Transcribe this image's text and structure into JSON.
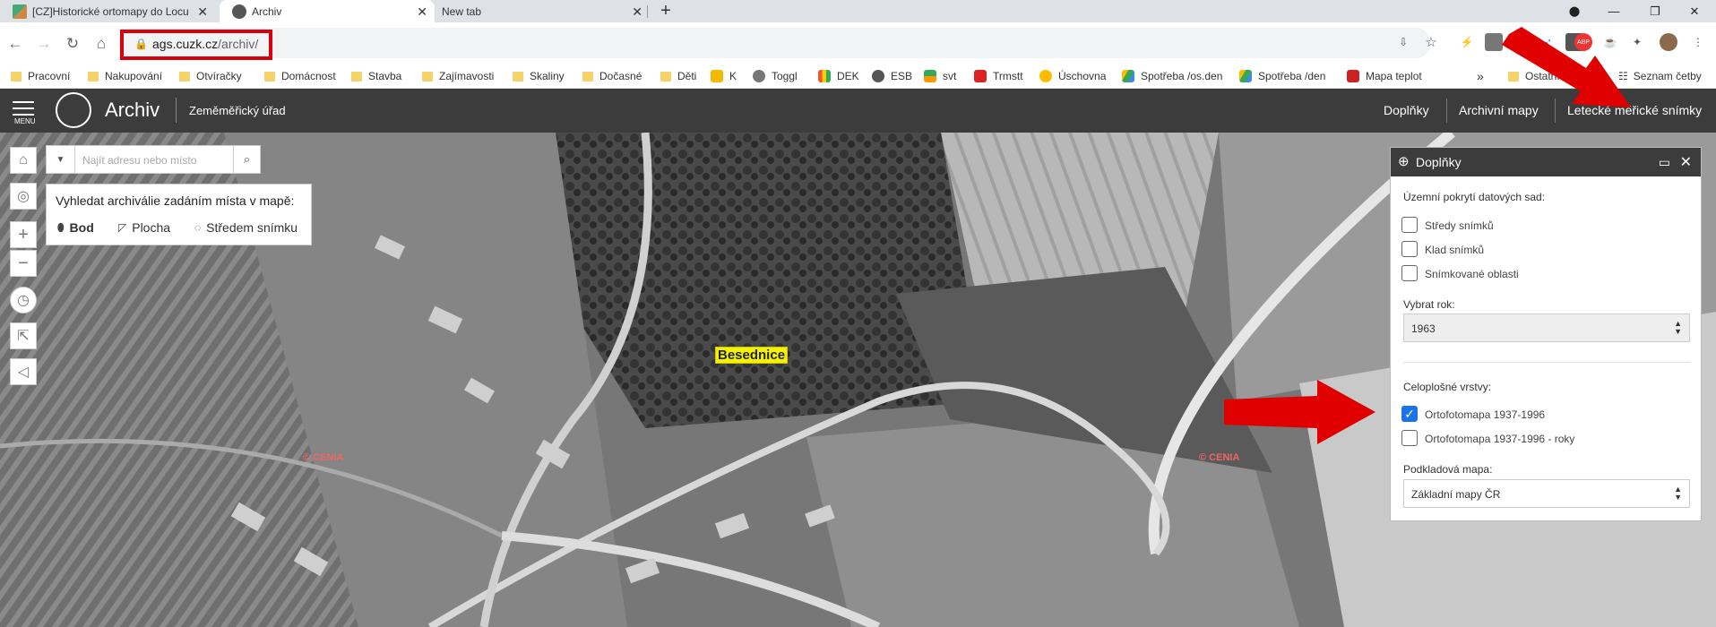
{
  "browser": {
    "tabs": [
      {
        "title": "[CZ]Historické ortomapy do Locu",
        "active": false
      },
      {
        "title": "Archiv",
        "active": true
      },
      {
        "title": "New tab",
        "active": false
      }
    ],
    "new_tab_icon": "plus-icon",
    "url": {
      "host": "ags.cuzk.cz",
      "path": "/archiv/"
    },
    "window_controls": [
      "minimize-icon",
      "restore-icon",
      "close-icon"
    ]
  },
  "bookmarks": [
    {
      "label": "Pracovní",
      "icon": "folder"
    },
    {
      "label": "Nakupování",
      "icon": "folder"
    },
    {
      "label": "Otvíračky",
      "icon": "folder"
    },
    {
      "label": "Domácnost",
      "icon": "folder"
    },
    {
      "label": "Stavba",
      "icon": "folder"
    },
    {
      "label": "Zajímavosti",
      "icon": "folder"
    },
    {
      "label": "Skaliny",
      "icon": "folder"
    },
    {
      "label": "Dočasné",
      "icon": "folder"
    },
    {
      "label": "Děti",
      "icon": "folder"
    },
    {
      "label": "K",
      "icon": "site"
    },
    {
      "label": "Toggl",
      "icon": "site"
    },
    {
      "label": "DEK",
      "icon": "site"
    },
    {
      "label": "ESB",
      "icon": "site"
    },
    {
      "label": "svt",
      "icon": "site"
    },
    {
      "label": "Trmstt",
      "icon": "site"
    },
    {
      "label": "Úschovna",
      "icon": "site"
    },
    {
      "label": "Spotřeba /os.den",
      "icon": "drive"
    },
    {
      "label": "Spotřeba /den",
      "icon": "drive"
    },
    {
      "label": "Mapa teplot",
      "icon": "site"
    }
  ],
  "bookmarks_overflow": "»",
  "bookmarks_other": "Ostatní",
  "reading_list": "Seznam četby",
  "app": {
    "menu_label": "MENU",
    "title": "Archiv",
    "organization": "Zeměměřický úřad",
    "nav": [
      "Doplňky",
      "Archivní mapy",
      "Letecké měřické snímky"
    ]
  },
  "map": {
    "search_placeholder": "Najít adresu nebo místo",
    "find_title": "Vyhledat archiválie zadáním místa v mapě:",
    "find_options": [
      "Bod",
      "Plocha",
      "Středem snímku"
    ],
    "place_label": "Besednice",
    "watermark": "© CENIA"
  },
  "panel": {
    "title": "Doplňky",
    "coverage_label": "Územní pokrytí datových sad:",
    "coverage_items": [
      {
        "label": "Středy snímků",
        "checked": false
      },
      {
        "label": "Klad snímků",
        "checked": false
      },
      {
        "label": "Snímkované oblasti",
        "checked": false
      }
    ],
    "year_label": "Vybrat rok:",
    "year_value": "1963",
    "layers_label": "Celoplošné vrstvy:",
    "layers": [
      {
        "label": "Ortofotomapa 1937-1996",
        "checked": true
      },
      {
        "label": "Ortofotomapa 1937-1996 - roky",
        "checked": false
      }
    ],
    "basemap_label": "Podkladová mapa:",
    "basemap_value": "Základní mapy ČR"
  },
  "annotations": {
    "color": "#e00000"
  }
}
